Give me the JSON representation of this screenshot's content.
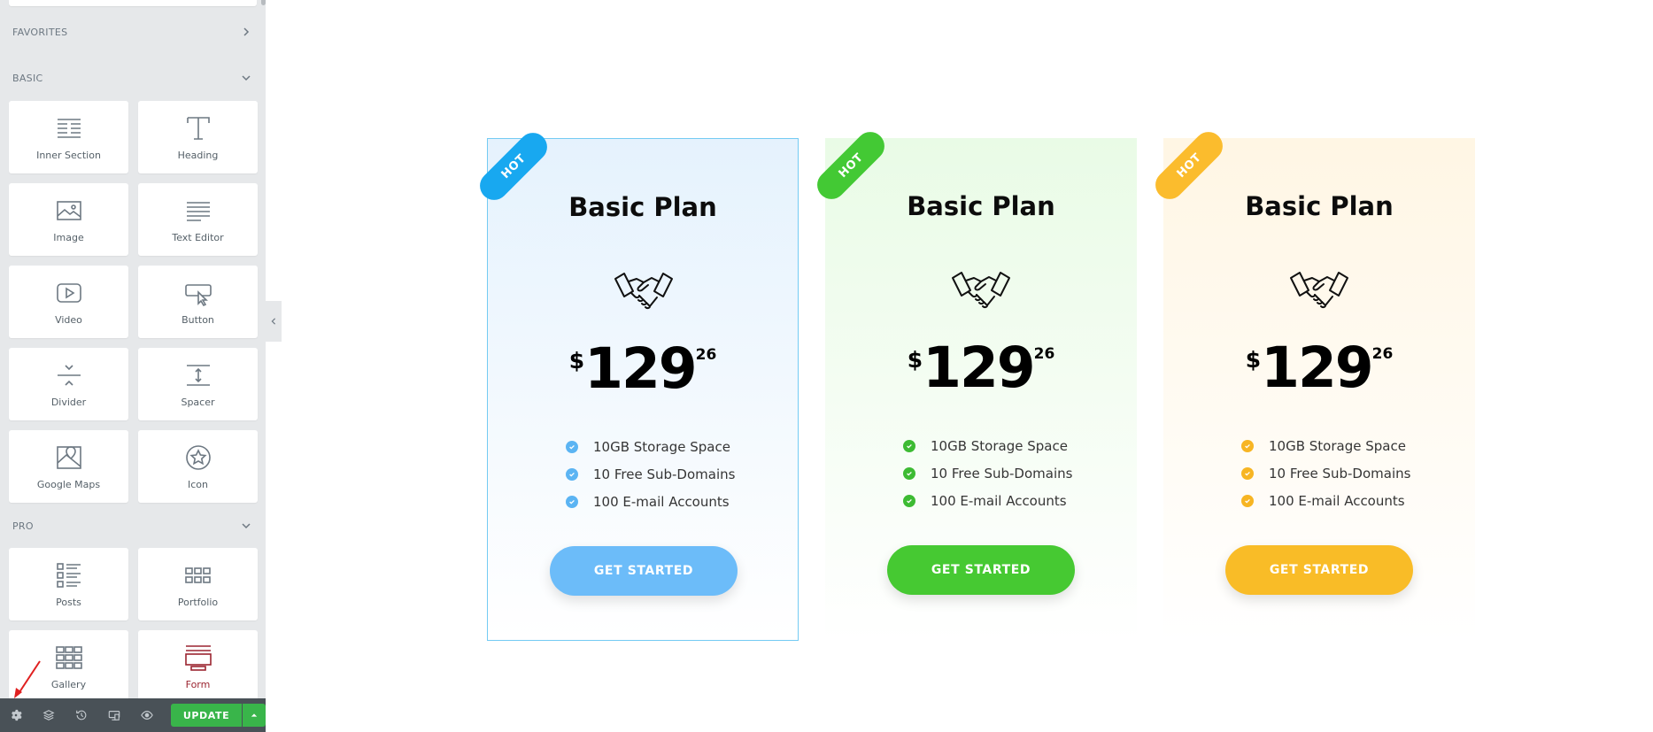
{
  "sidebar": {
    "categories": [
      {
        "label": "FAVORITES"
      },
      {
        "label": "BASIC"
      },
      {
        "label": "PRO"
      }
    ],
    "basic_widgets": [
      {
        "label": "Inner Section",
        "icon": "inner-section-icon"
      },
      {
        "label": "Heading",
        "icon": "heading-icon"
      },
      {
        "label": "Image",
        "icon": "image-icon"
      },
      {
        "label": "Text Editor",
        "icon": "text-editor-icon"
      },
      {
        "label": "Video",
        "icon": "video-icon"
      },
      {
        "label": "Button",
        "icon": "button-icon"
      },
      {
        "label": "Divider",
        "icon": "divider-icon"
      },
      {
        "label": "Spacer",
        "icon": "spacer-icon"
      },
      {
        "label": "Google Maps",
        "icon": "google-maps-icon"
      },
      {
        "label": "Icon",
        "icon": "star-icon"
      }
    ],
    "pro_widgets": [
      {
        "label": "Posts",
        "icon": "posts-icon"
      },
      {
        "label": "Portfolio",
        "icon": "portfolio-icon"
      },
      {
        "label": "Gallery",
        "icon": "gallery-icon"
      },
      {
        "label": "Form",
        "icon": "form-icon"
      }
    ]
  },
  "footer": {
    "update_label": "UPDATE",
    "icons": [
      "settings-icon",
      "navigator-icon",
      "history-icon",
      "responsive-mode-icon",
      "preview-icon"
    ]
  },
  "pricing": [
    {
      "badge": "HOT",
      "title": "Basic Plan",
      "currency": "$",
      "amount": "129",
      "cents": "26",
      "features": [
        "10GB Storage Space",
        "10 Free Sub-Domains",
        "100 E-mail Accounts"
      ],
      "button_label": "GET STARTED",
      "accent": "#18a8f0",
      "check_color": "#5bb4f3",
      "button_color": "#6cbcf9"
    },
    {
      "badge": "HOT",
      "title": "Basic Plan",
      "currency": "$",
      "amount": "129",
      "cents": "26",
      "features": [
        "10GB Storage Space",
        "10 Free Sub-Domains",
        "100 E-mail Accounts"
      ],
      "button_label": "GET STARTED",
      "accent": "#43c934",
      "check_color": "#3dbb33",
      "button_color": "#46c932"
    },
    {
      "badge": "HOT",
      "title": "Basic Plan",
      "currency": "$",
      "amount": "129",
      "cents": "26",
      "features": [
        "10GB Storage Space",
        "10 Free Sub-Domains",
        "100 E-mail Accounts"
      ],
      "button_label": "GET STARTED",
      "accent": "#fbbc2d",
      "check_color": "#f7b523",
      "button_color": "#f9bc27"
    }
  ]
}
